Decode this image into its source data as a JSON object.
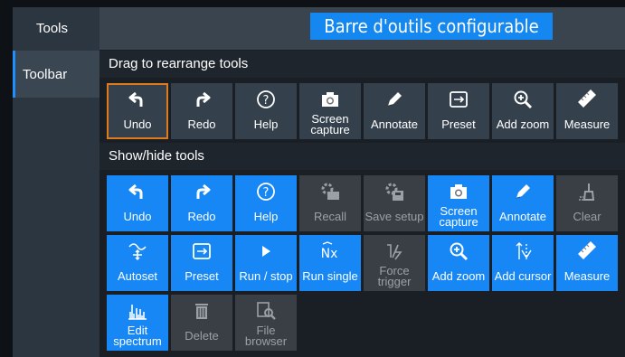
{
  "sidebar": {
    "title": "Tools",
    "items": [
      {
        "label": "Toolbar"
      }
    ]
  },
  "banner": "Barre d'outils configurable",
  "sections": {
    "arrange": "Drag to rearrange tools",
    "showhide": "Show/hide tools"
  },
  "toolbar_tools": [
    {
      "label": "Undo",
      "icon": "undo-icon"
    },
    {
      "label": "Redo",
      "icon": "redo-icon"
    },
    {
      "label": "Help",
      "icon": "help-icon"
    },
    {
      "label": "Screen capture",
      "icon": "camera-icon"
    },
    {
      "label": "Annotate",
      "icon": "pencil-icon"
    },
    {
      "label": "Preset",
      "icon": "preset-icon"
    },
    {
      "label": "Add zoom",
      "icon": "zoom-in-icon"
    },
    {
      "label": "Measure",
      "icon": "ruler-icon"
    }
  ],
  "all_tools": [
    {
      "label": "Undo",
      "icon": "undo-icon",
      "state": "on"
    },
    {
      "label": "Redo",
      "icon": "redo-icon",
      "state": "on"
    },
    {
      "label": "Help",
      "icon": "help-icon",
      "state": "on"
    },
    {
      "label": "Recall",
      "icon": "recall-icon",
      "state": "off"
    },
    {
      "label": "Save setup",
      "icon": "save-setup-icon",
      "state": "off"
    },
    {
      "label": "Screen capture",
      "icon": "camera-icon",
      "state": "on"
    },
    {
      "label": "Annotate",
      "icon": "pencil-icon",
      "state": "on"
    },
    {
      "label": "Clear",
      "icon": "clear-icon",
      "state": "off"
    },
    {
      "label": "Autoset",
      "icon": "autoset-icon",
      "state": "on"
    },
    {
      "label": "Preset",
      "icon": "preset-icon",
      "state": "on"
    },
    {
      "label": "Run / stop",
      "icon": "play-icon",
      "state": "on"
    },
    {
      "label": "Run single",
      "icon": "run-single-icon",
      "state": "on"
    },
    {
      "label": "Force trigger",
      "icon": "force-trigger-icon",
      "state": "off"
    },
    {
      "label": "Add zoom",
      "icon": "zoom-in-icon",
      "state": "on"
    },
    {
      "label": "Add cursor",
      "icon": "cursor-icon",
      "state": "on"
    },
    {
      "label": "Measure",
      "icon": "ruler-icon",
      "state": "on"
    },
    {
      "label": "Edit spectrum",
      "icon": "spectrum-icon",
      "state": "on"
    },
    {
      "label": "Delete",
      "icon": "trash-icon",
      "state": "off"
    },
    {
      "label": "File browser",
      "icon": "file-browser-icon",
      "state": "off"
    }
  ],
  "colors": {
    "accent": "#1687f5",
    "selected_outline": "#e07a1c",
    "tile_dark": "#34414c",
    "tile_off": "#3a3f45"
  }
}
